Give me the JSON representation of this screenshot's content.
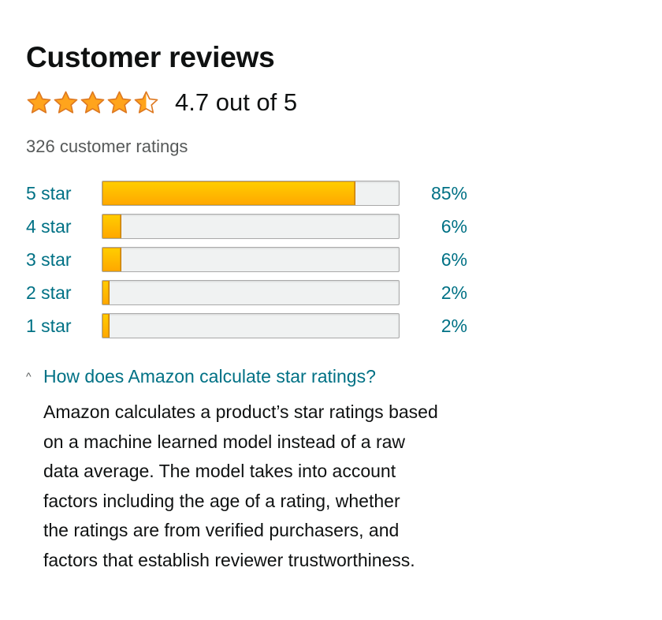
{
  "header": {
    "title": "Customer reviews"
  },
  "summary": {
    "rating": 4.7,
    "rating_text": "4.7 out of 5",
    "stars": [
      "full",
      "full",
      "full",
      "full",
      "half"
    ],
    "ratings_count_text": "326 customer ratings"
  },
  "histogram": {
    "rows": [
      {
        "label": "5 star",
        "percent_text": "85%",
        "fraction": 0.85
      },
      {
        "label": "4 star",
        "percent_text": "6%",
        "fraction": 0.06
      },
      {
        "label": "3 star",
        "percent_text": "6%",
        "fraction": 0.06
      },
      {
        "label": "2 star",
        "percent_text": "2%",
        "fraction": 0.02
      },
      {
        "label": "1 star",
        "percent_text": "2%",
        "fraction": 0.02
      }
    ]
  },
  "disclosure": {
    "caret_icon": "chevron-up-icon",
    "caret_glyph": "^",
    "link_text": "How does Amazon calculate star ratings?",
    "body_lines": [
      "Amazon calculates a product’s star ratings based",
      "on a machine learned model instead of a raw",
      "data average. The model takes into account",
      "factors including the age of a rating, whether",
      "the ratings are from verified purchasers, and",
      "factors that establish reviewer trustworthiness."
    ]
  },
  "colors": {
    "link": "#007185",
    "star_fill": "#ffa41c",
    "bar_fill": "#ffa700",
    "muted_text": "#565959"
  }
}
